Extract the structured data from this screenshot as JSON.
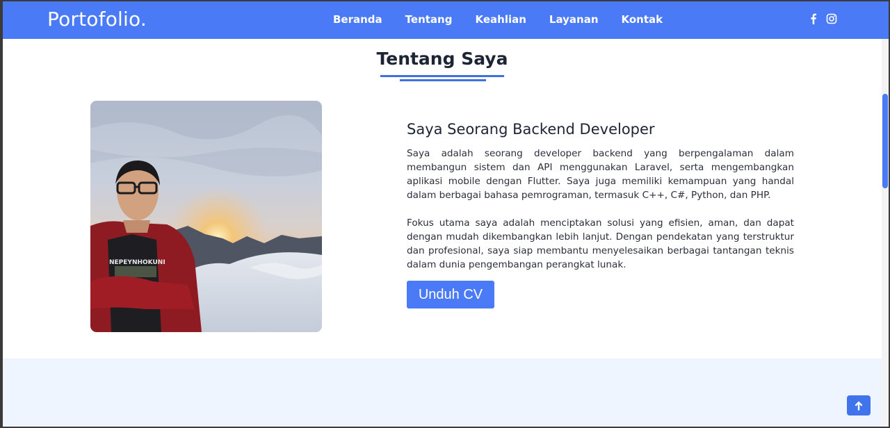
{
  "brand": {
    "logo": "Portofolio.",
    "accent_color": "#4a7af5"
  },
  "nav": {
    "items": [
      {
        "label": "Beranda"
      },
      {
        "label": "Tentang"
      },
      {
        "label": "Keahlian"
      },
      {
        "label": "Layanan"
      },
      {
        "label": "Kontak"
      }
    ],
    "social_icons": [
      "facebook-icon",
      "instagram-icon"
    ]
  },
  "about": {
    "section_title": "Tentang Saya",
    "heading": "Saya Seorang Backend Developer",
    "paragraph_1": "Saya adalah seorang developer backend yang berpengalaman dalam membangun sistem dan API menggunakan Laravel, serta mengembangkan aplikasi mobile dengan Flutter. Saya juga memiliki kemampuan yang handal dalam berbagai bahasa pemrograman, termasuk C++, C#, Python, dan PHP.",
    "paragraph_2": "Fokus utama saya adalah menciptakan solusi yang efisien, aman, dan dapat dengan mudah dikembangkan lebih lanjut. Dengan pendekatan yang terstruktur dan profesional, saya siap membantu menyelesaikan berbagai tantangan teknis dalam dunia pengembangan perangkat lunak.",
    "cv_button": "Unduh CV",
    "photo_shirt_text": "NEPEYNHOKUNI"
  },
  "back_to_top_icon": "arrow-up-icon"
}
